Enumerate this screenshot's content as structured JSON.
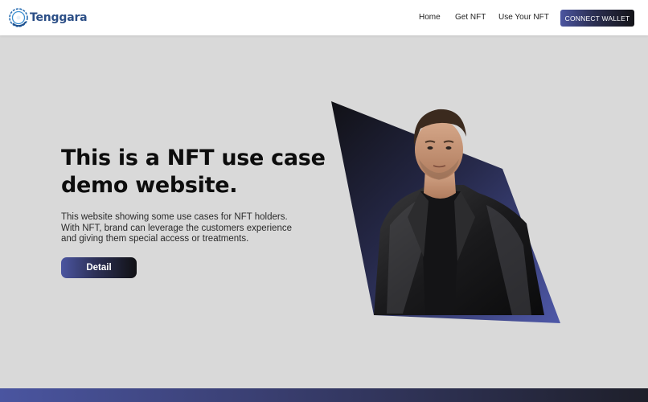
{
  "header": {
    "brand": "Tenggara",
    "nav": {
      "home": "Home",
      "get_nft": "Get NFT",
      "use_nft": "Use Your NFT"
    },
    "connect_label": "CONNECT WALLET"
  },
  "hero": {
    "title_line1": "This is a NFT use case",
    "title_line2": "demo website.",
    "desc_line1": "This website showing some use cases for NFT holders.",
    "desc_line2": "With NFT, brand can leverage the customers experience",
    "desc_line3": "and giving them special access or treatments.",
    "detail_label": "Detail"
  },
  "colors": {
    "accent": "#4b55a0",
    "dark": "#141418",
    "brand_text": "#2b4e86",
    "background": "#d9d9d9"
  },
  "icons": {
    "logo": "circular-arrow-logo-icon"
  },
  "image": {
    "hero_subject": "man-in-leather-jacket-portrait"
  }
}
